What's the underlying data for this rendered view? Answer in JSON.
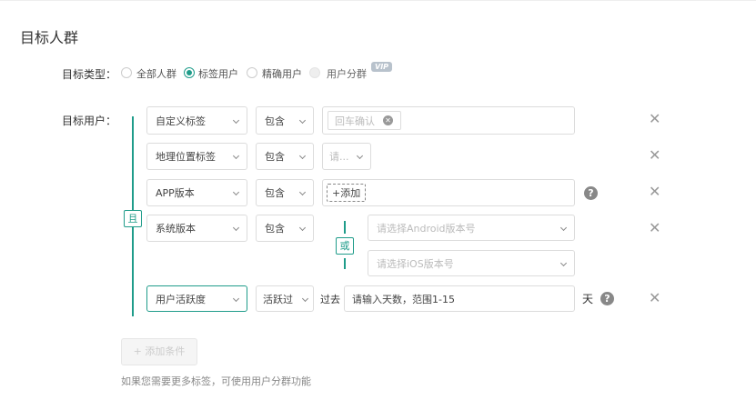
{
  "title": "目标人群",
  "target_type": {
    "label": "目标类型：",
    "options": [
      "全部人群",
      "标签用户",
      "精确用户",
      "用户分群"
    ],
    "selected": "标签用户",
    "vip_badge": "VIP"
  },
  "target_users": {
    "label": "目标用户：",
    "and_label": "且",
    "or_label": "或",
    "rows": [
      {
        "field": "自定义标签",
        "op": "包含",
        "tag_placeholder": "回车确认"
      },
      {
        "field": "地理位置标签",
        "op": "包含",
        "value_placeholder": "请..."
      },
      {
        "field": "APP版本",
        "op": "包含",
        "add_label": "+添加"
      },
      {
        "field": "系统版本",
        "op": "包含",
        "android_placeholder": "请选择Android版本号",
        "ios_placeholder": "请选择iOS版本号"
      },
      {
        "field": "用户活跃度",
        "op": "活跃过",
        "prefix": "过去",
        "input_placeholder": "请输入天数，范围1-15",
        "suffix": "天"
      }
    ]
  },
  "add_condition": "+ 添加条件",
  "hint": "如果您需要更多标签，可使用用户分群功能",
  "accent": "#1f9c8a"
}
